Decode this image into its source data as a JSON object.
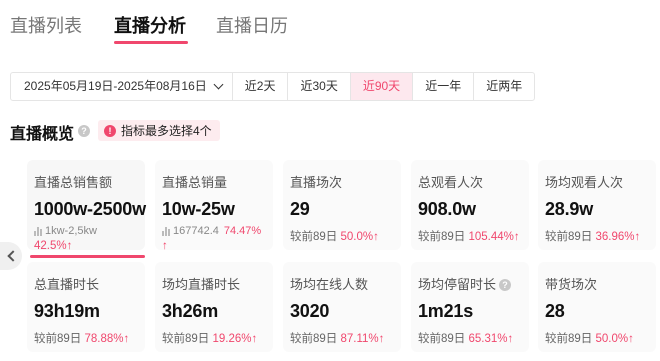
{
  "tabs": [
    "直播列表",
    "直播分析",
    "直播日历"
  ],
  "filters": {
    "date_range": "2025年05月19日-2025年08月16日",
    "options": [
      "近2天",
      "近30天",
      "近90天",
      "近一年",
      "近两年"
    ],
    "active": "近90天"
  },
  "overview": {
    "title": "直播概览",
    "notice": "指标最多选择4个"
  },
  "cards": [
    {
      "label": "直播总销售额",
      "value": "1000w-2500w",
      "range": "1kw-2,5kw",
      "change": "42.5%"
    },
    {
      "label": "直播总销量",
      "value": "10w-25w",
      "range": "167742.4",
      "change": "74.47%"
    },
    {
      "label": "直播场次",
      "value": "29",
      "compare": "较前89日",
      "change": "50.0%"
    },
    {
      "label": "总观看人次",
      "value": "908.0w",
      "compare": "较前89日",
      "change": "105.44%"
    },
    {
      "label": "场均观看人次",
      "value": "28.9w",
      "compare": "较前89日",
      "change": "36.96%"
    },
    {
      "label": "总直播时长",
      "value": "93h19m",
      "compare": "较前89日",
      "change": "78.88%"
    },
    {
      "label": "场均直播时长",
      "value": "3h26m",
      "compare": "较前89日",
      "change": "19.26%"
    },
    {
      "label": "场均在线人数",
      "value": "3020",
      "compare": "较前89日",
      "change": "87.11%"
    },
    {
      "label": "场均停留时长",
      "value": "1m21s",
      "compare": "较前89日",
      "change": "65.31%"
    },
    {
      "label": "带货场次",
      "value": "28",
      "compare": "较前89日",
      "change": "50.0%"
    }
  ],
  "icons": {
    "up_arrow": "↑",
    "help": "?",
    "notice": "!"
  },
  "colors": {
    "accent": "#f0476d",
    "active_bg": "#fde8ee"
  }
}
